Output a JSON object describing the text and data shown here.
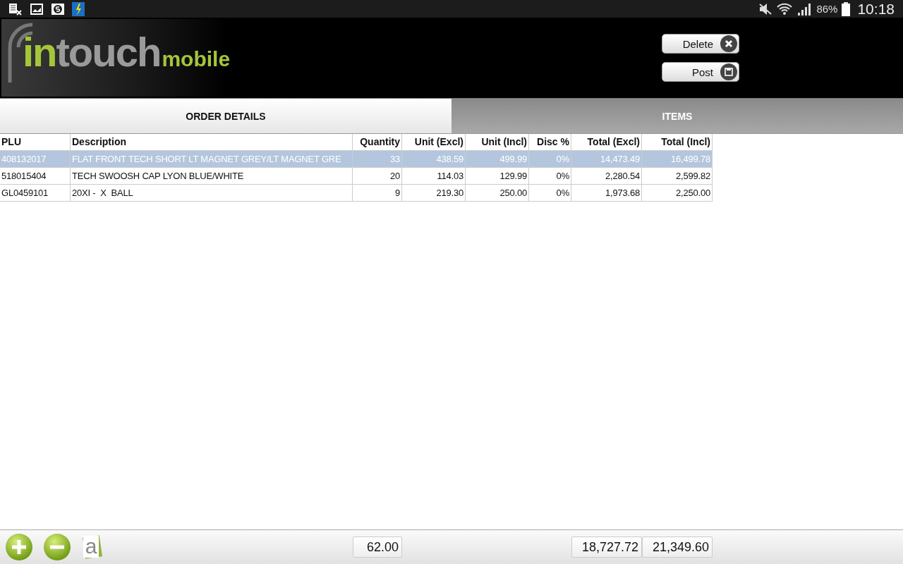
{
  "status_bar": {
    "battery": "86%",
    "time": "10:18"
  },
  "logo": {
    "part_1": "in",
    "part_2": "touch",
    "part_3": "mobile"
  },
  "actions": [
    {
      "label": "Delete",
      "kind": "delete"
    },
    {
      "label": "Post",
      "kind": "save"
    }
  ],
  "tabs": [
    {
      "label": "ORDER DETAILS",
      "selected": false
    },
    {
      "label": "ITEMS",
      "selected": true
    }
  ],
  "table": {
    "columns": [
      "PLU",
      "Description",
      "Quantity",
      "Unit (Excl)",
      "Unit (Incl)",
      "Disc %",
      "Total (Excl)",
      "Total (Incl)"
    ],
    "rows": [
      {
        "selected": true,
        "cells": [
          "408132017",
          "FLAT FRONT TECH SHORT LT MAGNET GREY/LT MAGNET GRE",
          "33",
          "438.59",
          "499.99",
          "0%",
          "14,473.49",
          "16,499.78"
        ]
      },
      {
        "selected": false,
        "cells": [
          "518015404",
          "TECH SWOOSH CAP LYON BLUE/WHITE",
          "20",
          "114.03",
          "129.99",
          "0%",
          "2,280.54",
          "2,599.82"
        ]
      },
      {
        "selected": false,
        "cells": [
          "GL0459101",
          "20XI -  X  BALL",
          "9",
          "219.30",
          "250.00",
          "0%",
          "1,973.68",
          "2,250.00"
        ]
      }
    ]
  },
  "footer": {
    "notes_glyph": "a",
    "total_quantity": "62.00",
    "total_excl": "18,727.72",
    "total_incl": "21,349.60"
  }
}
